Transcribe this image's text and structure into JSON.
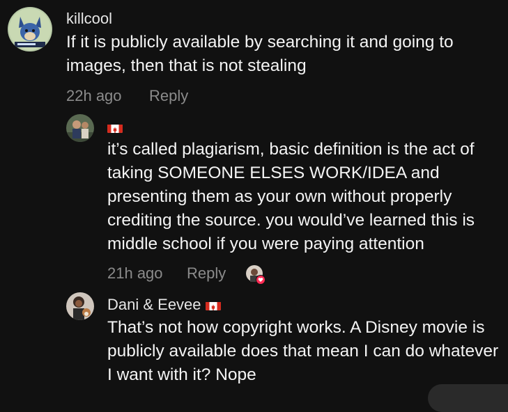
{
  "comments": [
    {
      "username": "killcool",
      "text": "If it is publicly available by searching it and going to images, then that is not stealing",
      "time": "22h ago",
      "reply_label": "Reply"
    },
    {
      "username": "",
      "flag": "canada-flag-icon",
      "text": "it’s called plagiarism, basic definition is the act of taking SOMEONE ELSES WORK/IDEA and presenting them as your own without properly crediting the source. you would’ve learned this is middle school if you were paying attention",
      "time": "21h ago",
      "reply_label": "Reply",
      "liked_by_creator": true
    },
    {
      "username": "Dani & Eevee",
      "flag": "canada-flag-icon",
      "text": "That’s not how copyright works. A Disney movie is publicly available does that mean I can do whatever I want with it? Nope"
    }
  ],
  "colors": {
    "background": "#111111",
    "text": "#f4f4f4",
    "meta": "#8b8b8b",
    "flag_red": "#d52b1e",
    "like_heart": "#fe2c55"
  }
}
